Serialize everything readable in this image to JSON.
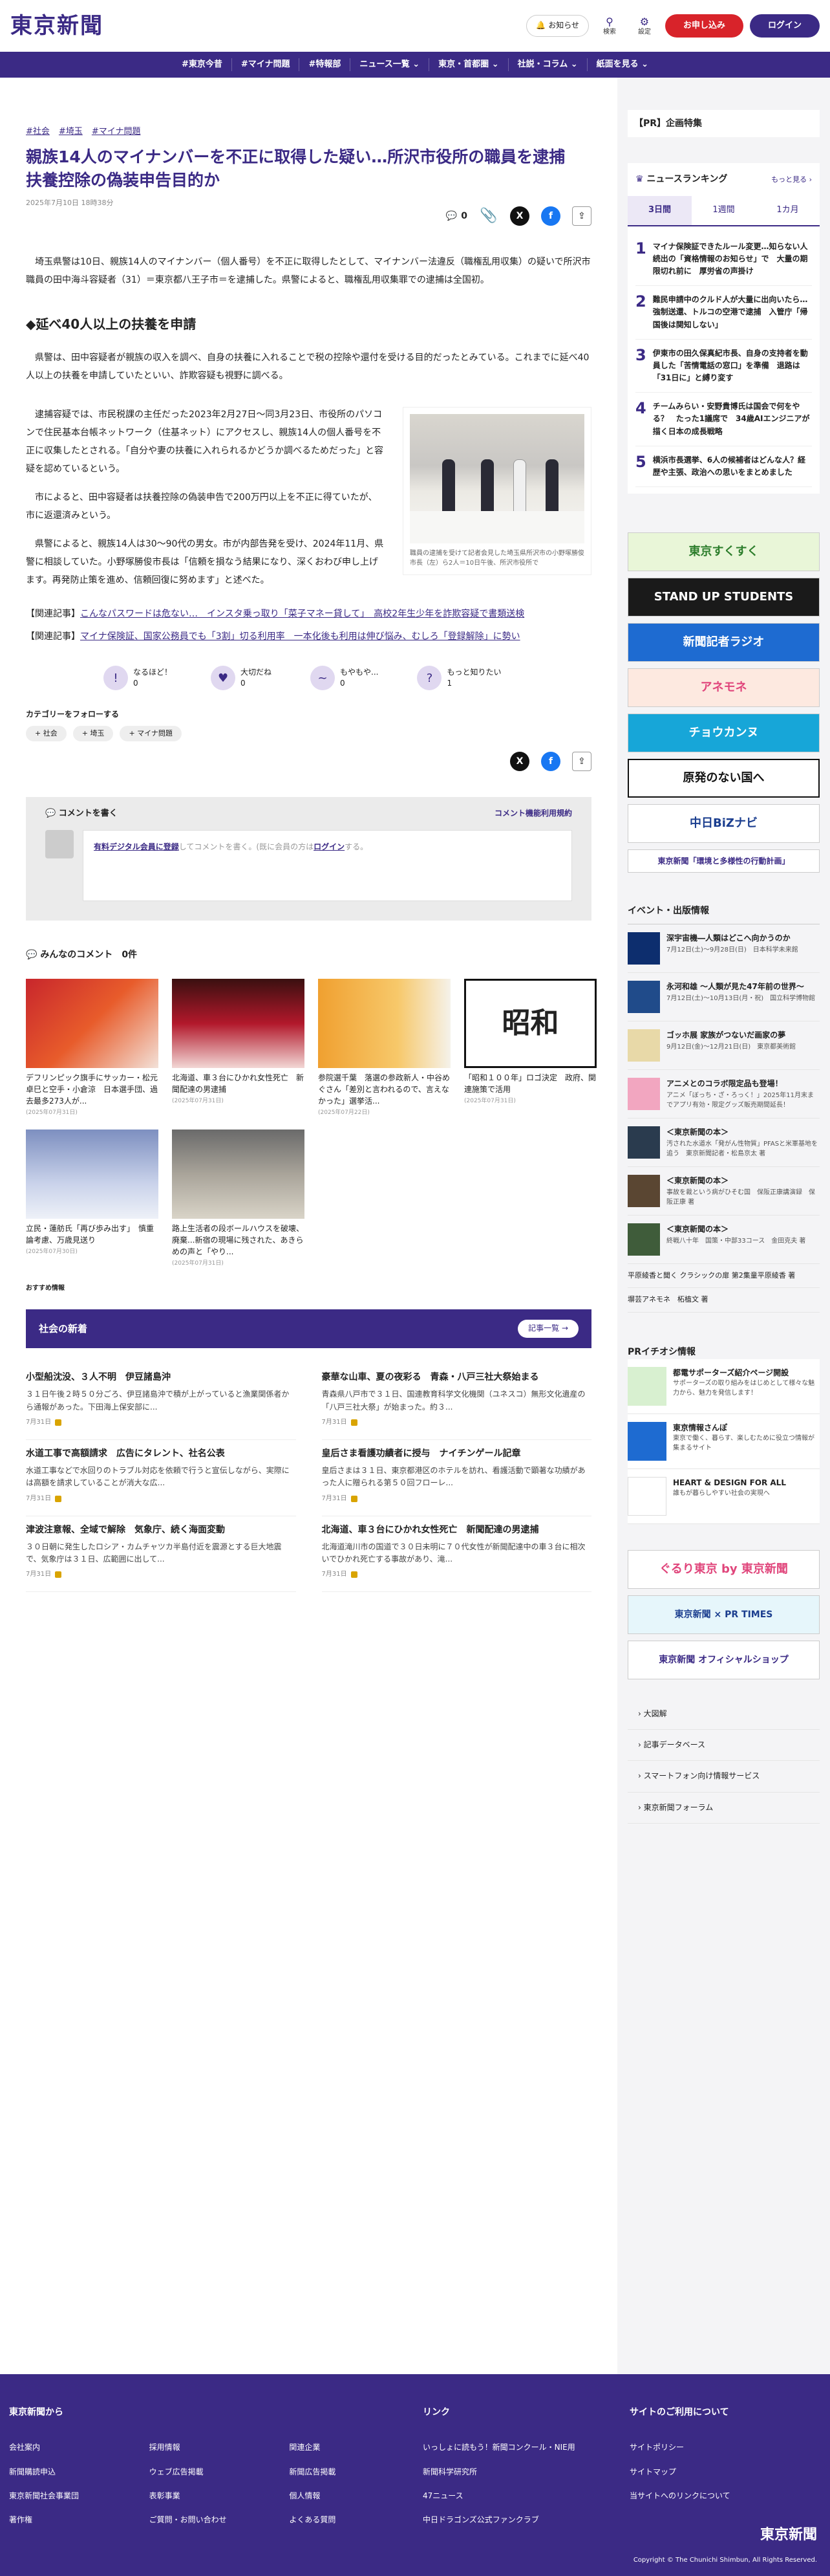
{
  "header": {
    "logo": "東京新聞",
    "notice": "お知らせ",
    "search": "検索",
    "settings": "設定",
    "signup": "お申し込み",
    "login": "ログイン"
  },
  "nav": [
    "#東京今昔",
    "#マイナ問題",
    "#特報部",
    "ニュース一覧 ⌄",
    "東京・首都圏 ⌄",
    "社説・コラム ⌄",
    "紙面を見る ⌄"
  ],
  "article": {
    "tags": [
      "#社会",
      "#埼玉",
      "#マイナ問題"
    ],
    "title": "親族14人のマイナンバーを不正に取得した疑い…所沢市役所の職員を逮捕　扶養控除の偽装申告目的か",
    "date": "2025年7月10日 18時38分",
    "comment_count": "0",
    "lead": "埼玉県警は10日、親族14人のマイナンバー（個人番号）を不正に取得したとして、マイナンバー法違反（職権乱用収集）の疑いで所沢市職員の田中海斗容疑者（31）＝東京都八王子市＝を逮捕した。県警によると、職権乱用収集罪での逮捕は全国初。",
    "h2": "◆延べ40人以上の扶養を申請",
    "p2": "県警は、田中容疑者が親族の収入を調べ、自身の扶養に入れることで税の控除や還付を受ける目的だったとみている。これまでに延べ40人以上の扶養を申請していたといい、詐欺容疑も視野に調べる。",
    "p3": "逮捕容疑では、市民税課の主任だった2023年2月27日〜同3月23日、市役所のパソコンで住民基本台帳ネットワーク（住基ネット）にアクセスし、親族14人の個人番号を不正に収集したとされる。「自分や妻の扶養に入れられるかどうか調べるためだった」と容疑を認めているという。",
    "p4": "市によると、田中容疑者は扶養控除の偽装申告で200万円以上を不正に得ていたが、市に返還済みという。",
    "p5": "県警によると、親族14人は30〜90代の男女。市が内部告発を受け、2024年11月、県警に相談していた。小野塚勝俊市長は「信頼を損なう結果になり、深くおわび申し上げます。再発防止策を進め、信頼回復に努めます」と述べた。",
    "caption": "職員の逮捕を受けて記者会見した埼玉県所沢市の小野塚勝俊市長（左）ら2人＝10日午後、所沢市役所で",
    "related": [
      {
        "label": "【関連記事】",
        "text": "こんなパスワードは危ない…　インスタ乗っ取り「菜子マネー貸して」　高校2年生少年を詐欺容疑で書類送検"
      },
      {
        "label": "【関連記事】",
        "text": "マイナ保険証、国家公務員でも「3割」切る利用率　一本化後も利用は伸び悩み、むしろ「登録解除」に勢い"
      }
    ]
  },
  "reactions": [
    {
      "label": "なるほど！",
      "count": "0",
      "icon": "lightbulb-icon",
      "glyph": "!"
    },
    {
      "label": "大切だね",
      "count": "0",
      "icon": "heart-icon",
      "glyph": "♥"
    },
    {
      "label": "もやもや...",
      "count": "0",
      "icon": "cloud-icon",
      "glyph": "~"
    },
    {
      "label": "もっと知りたい",
      "count": "1",
      "icon": "question-icon",
      "glyph": "?"
    }
  ],
  "follow": {
    "title": "カテゴリーをフォローする",
    "tags": [
      "+ 社会",
      "+ 埼玉",
      "+ マイナ問題"
    ]
  },
  "comment_box": {
    "head": "コメントを書く",
    "rules": "コメント機能利用規約",
    "placeholder_link": "有料デジタル会員に登録",
    "placeholder_mid": "してコメントを書く。(既に会員の方は",
    "placeholder_login": "ログイン",
    "placeholder_end": "する。"
  },
  "comments_header": {
    "label": "みんなのコメント",
    "count": "0件"
  },
  "cards": [
    {
      "title": "デフリンピック旗手にサッカー・松元卓巳と空手・小倉涼　日本選手団、過去最多273人が...",
      "date": "(2025年07月31日)"
    },
    {
      "title": "北海道、車３台にひかれ女性死亡　新聞配達の男逮捕",
      "date": "(2025年07月31日)"
    },
    {
      "title": "参院選千葉　落選の参政新人・中谷めぐさん「差別と言われるので、言えなかった」選挙活...",
      "date": "(2025年07月22日)"
    },
    {
      "title": "「昭和１００年」ロゴ決定　政府、関連施策で活用",
      "date": "(2025年07月31日)"
    },
    {
      "title": "立民・蓮舫氏「再び歩み出す」　慎重論考慮、万歳見送り",
      "date": "(2025年07月30日)"
    },
    {
      "title": "路上生活者の段ボールハウスを破壊、廃棄...新宿の現場に残された、あきらめの声と「やり...",
      "date": "(2025年07月31日)"
    }
  ],
  "recommend": "おすすめ情報",
  "newsbar": {
    "title": "社会の新着",
    "btn": "記事一覧 →"
  },
  "news": [
    {
      "title": "小型船沈没、３人不明　伊豆諸島沖",
      "excerpt": "３１日午後２時５０分ごろ、伊豆諸島沖で積が上がっていると漁業関係者から通報があった。下田海上保安部に...",
      "date": "7月31日"
    },
    {
      "title": "豪華な山車、夏の夜彩る　青森・八戸三社大祭始まる",
      "excerpt": "青森県八戸市で３１日、国連教育科学文化機関（ユネスコ）無形文化遺産の「八戸三社大祭」が始まった。約３...",
      "date": "7月31日"
    },
    {
      "title": "水道工事で高額請求　広告にタレント、社名公表",
      "excerpt": "水道工事などで水回りのトラブル対応を依頼で行うと宣伝しながら、実際には高額を請求していることが消大な広...",
      "date": "7月31日"
    },
    {
      "title": "皇后さま看護功績者に授与　ナイチンゲール記章",
      "excerpt": "皇后さまは３１日、東京都港区のホテルを訪れ、看護活動で顕著な功績があった人に贈られる第５０回フローレ...",
      "date": "7月31日"
    },
    {
      "title": "津波注意報、全域で解除　気象庁、続く海面変動",
      "excerpt": "３０日朝に発生したロシア・カムチャツカ半島付近を震源とする巨大地震で、気象庁は３１日、広範囲に出して...",
      "date": "7月31日"
    },
    {
      "title": "北海道、車３台にひかれ女性死亡　新聞配達の男逮捕",
      "excerpt": "北海道滝川市の国道で３０日未明に７０代女性が新聞配達中の車３台に相次いでひかれ死亡する事故があり、滝...",
      "date": "7月31日"
    }
  ],
  "side": {
    "pr": "【PR】企画特集",
    "rank_title": "ニュースランキング",
    "rank_more": "もっと見る ›",
    "tabs": [
      "3日間",
      "1週間",
      "1カ月"
    ],
    "ranking": [
      "マイナ保険証できたルール変更…知らない人続出の「資格情報のお知らせ」で　大量の期限切れ前に　厚労省の声掛け",
      "難民申請中のクルド人が大量に出向いたら…強制送還、トルコの空港で逮捕　入管庁「帰国後は関知しない」",
      "伊東市の田久保真紀市長、自身の支持者を動員した「苦情電話の窓口」を準備　退路は「31日に」と縛り変す",
      "チームみらい・安野貴博氏は国会で何をやる？　たった1議席で　34歳AIエンジニアが描く日本の成長戦略",
      "横浜市長選挙、6人の候補者はどんな人？経歴や主張、政治への思いをまとめました"
    ],
    "banners": [
      "東京すくすく",
      "STAND UP STUDENTS",
      "新聞記者ラジオ",
      "アネモネ",
      "チョウカンヌ",
      "原発のない国へ",
      "中日BiZナビ",
      "東京新聞「環境と多様性の行動計画」"
    ],
    "event_title": "イベント・出版情報",
    "events": [
      {
        "title": "深宇宙機―人類はどこへ向かうのか",
        "desc": "7月12日(土)〜9月28日(日)　日本科学未来館"
      },
      {
        "title": "永河和雄 ～人類が見た47年前の世界～",
        "desc": "7月12日(土)〜10月13日(月・祝)　国立科学博物館"
      },
      {
        "title": "ゴッホ展 家族がつないだ画家の夢",
        "desc": "9月12日(金)〜12月21日(日)　東京都美術館"
      },
      {
        "title": "アニメとのコラボ限定品も登場！",
        "desc": "アニメ「ぼっち・ざ・ろっく！」2025年11月末までアプリ有効・限定グッズ販売期間延長！"
      },
      {
        "title": "＜東京新聞の本＞",
        "desc": "汚された水道水「発がん性物質」PFASと米軍基地を追う　東京新聞記者・松島京太 著"
      },
      {
        "title": "＜東京新聞の本＞",
        "desc": "事故を裁という病がひそむ国　保阪正康講演録　保阪正康 著"
      },
      {
        "title": "＜東京新聞の本＞",
        "desc": "終戦八十年　国策・中部33コース　金田克夫 著"
      }
    ],
    "ev_links": [
      "平原綾香と聞く クラシックの扉 第2集童平原綾香 著",
      "塀芸アネモネ　柘植文 著"
    ],
    "pri_title": "PRイチオシ情報",
    "pri": [
      {
        "title": "都電サポーターズ紹介ページ開設",
        "desc": "サポーターズの取り組みをはじめとして様々な魅力から、魅力を発信します！"
      },
      {
        "title": "東京情報さんぽ",
        "desc": "東京で働く、暮らす、楽しむために役立つ情報が集まるサイト"
      },
      {
        "title": "HEART & DESIGN FOR ALL",
        "desc": "誰もが暮らしやすい社会の実現へ"
      }
    ],
    "banners2": [
      "ぐるり東京 by 東京新聞",
      "東京新聞 × PR TIMES",
      "東京新聞 オフィシャルショップ"
    ],
    "links": [
      "大図解",
      "記事データベース",
      "スマートフォン向け情報サービス",
      "東京新聞フォーラム"
    ]
  },
  "footer": {
    "col1_title": "東京新聞から",
    "col1": [
      "会社案内",
      "採用情報",
      "関連企業",
      "新聞購読申込",
      "ウェブ広告掲載",
      "新聞広告掲載",
      "東京新聞社会事業団",
      "表彰事業",
      "個人情報",
      "著作権",
      "ご質問・お問い合わせ",
      "よくある質問"
    ],
    "col2_title": "リンク",
    "col2": [
      "いっしょに読もう！新聞コンクール・NIE用",
      "新聞科学研究所",
      "47ニュース",
      "中日ドラゴンズ公式ファンクラブ"
    ],
    "col3_title": "サイトのご利用について",
    "col3": [
      "サイトポリシー",
      "サイトマップ",
      "当サイトへのリンクについて"
    ],
    "logo": "東京新聞",
    "copyright": "Copyright © The Chunichi Shimbun, All Rights Reserved."
  }
}
